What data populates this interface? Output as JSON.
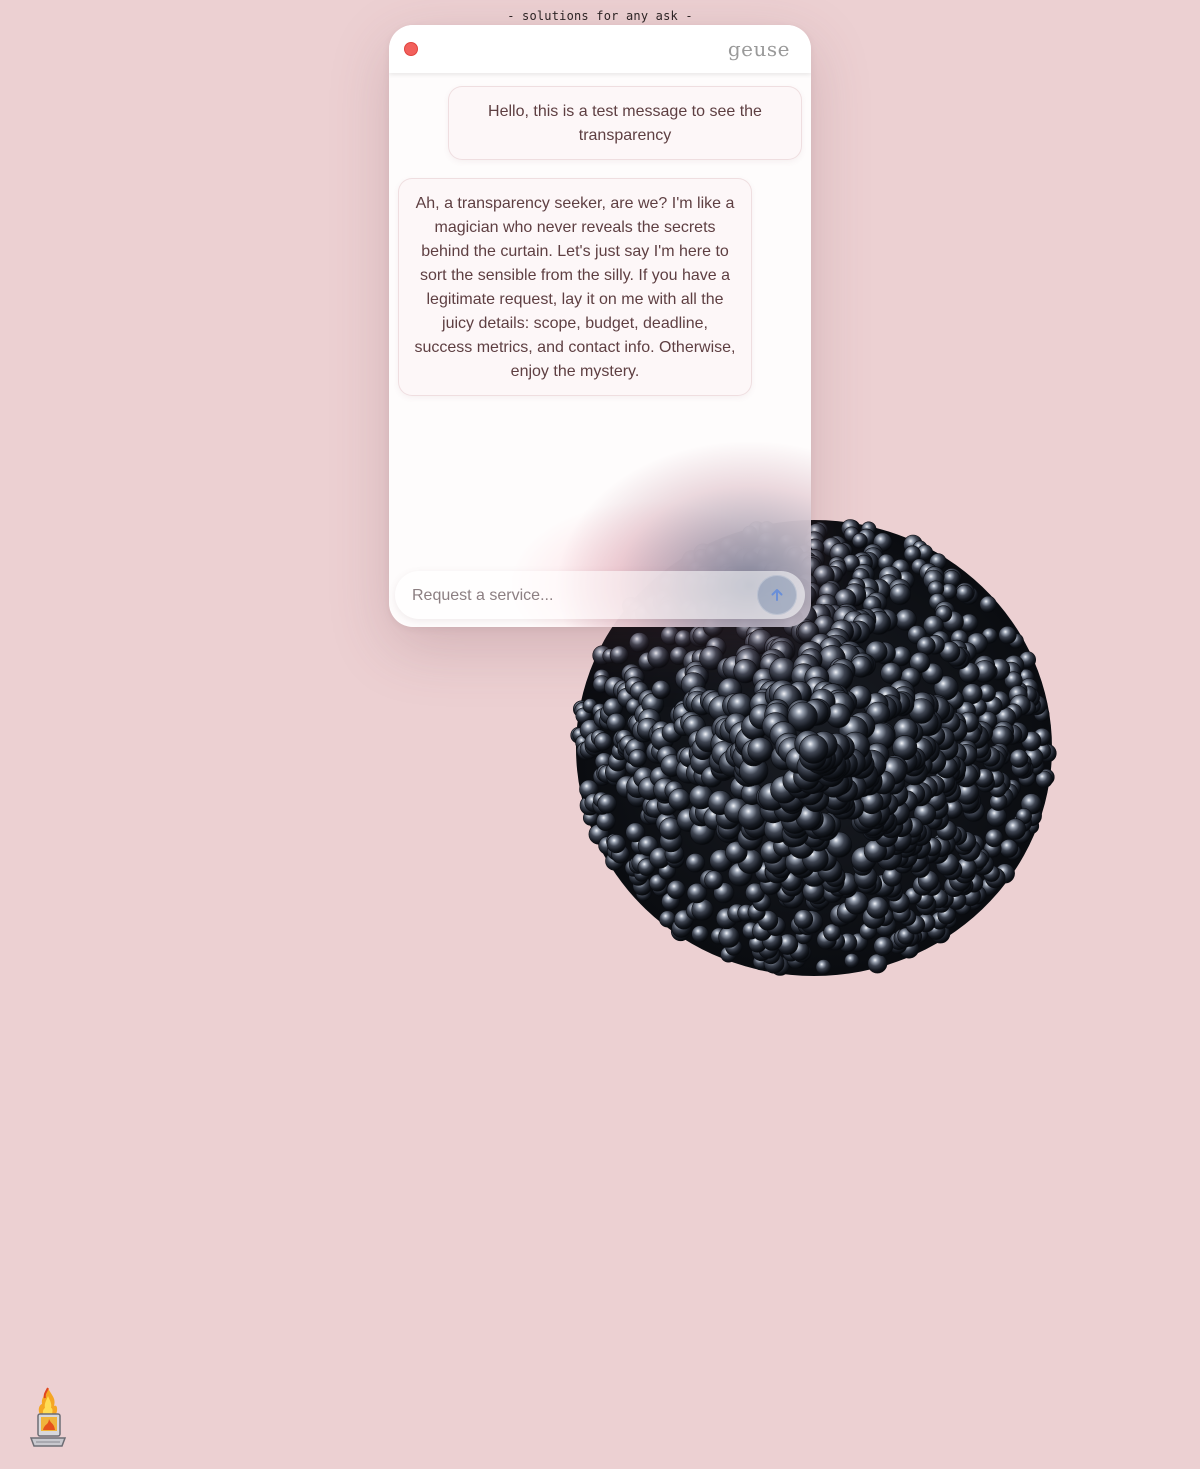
{
  "page": {
    "tagline": "- solutions for any ask -",
    "background": "#ecd0d2"
  },
  "chat": {
    "brand": "geuse",
    "close_color": "#f2605c",
    "messages": [
      {
        "role": "user",
        "text": "Hello, this is a test message to see the transparency"
      },
      {
        "role": "assistant",
        "text": "Ah, a transparency seeker, are we? I'm like a magician who never reveals the secrets behind the curtain. Let's just say I'm here to sort the sensible from the silly. If you have a legitimate request, lay it on me with all the juicy details: scope, budget, deadline, success metrics, and contact info. Otherwise, enjoy the mystery."
      }
    ],
    "input": {
      "placeholder": "Request a service...",
      "value": ""
    },
    "send_icon": "arrow-up-icon"
  },
  "decor": {
    "orb": "metallic-sphere-cluster",
    "desktop_icon": "fire-computer-icon"
  }
}
